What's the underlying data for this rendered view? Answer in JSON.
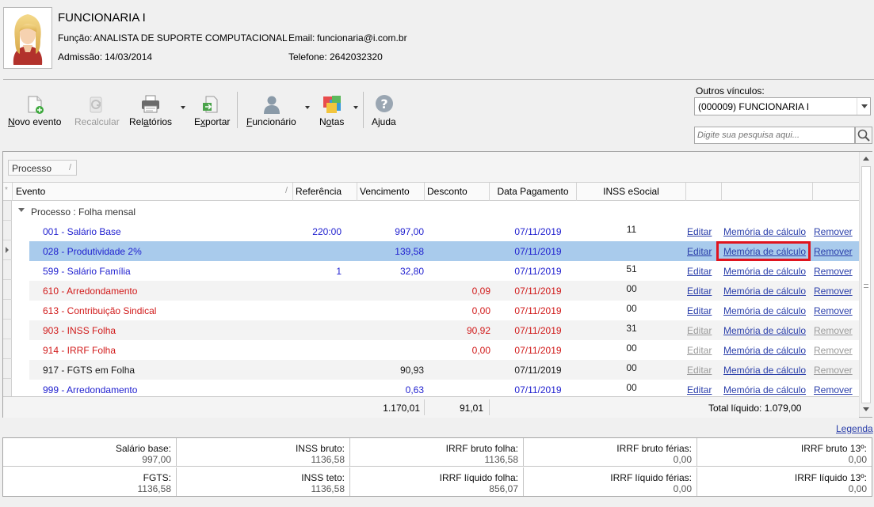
{
  "employee": {
    "name": "FUNCIONARIA I",
    "funcao_label": "Função:",
    "funcao": "ANALISTA DE SUPORTE COMPUTACIONAL",
    "email_label": "Email:",
    "email": "funcionaria@i.com.br",
    "admissao_label": "Admissão:",
    "admissao": "14/03/2014",
    "telefone_label": "Telefone:",
    "telefone": "2642032320",
    "avatar_icon": "female-user-avatar-icon"
  },
  "toolbar": {
    "novo_evento": {
      "pre": "N",
      "post": "ovo evento",
      "icon": "new-document-icon"
    },
    "recalcular": {
      "label": "Recalcular",
      "icon": "recalculate-icon",
      "disabled": true
    },
    "relatorios": {
      "pre": "Rel",
      "u": "a",
      "post": "tórios",
      "icon": "printer-icon"
    },
    "exportar": {
      "pre": "E",
      "u": "x",
      "post": "portar",
      "icon": "export-icon"
    },
    "funcionario": {
      "pre": "",
      "u": "F",
      "post": "uncionário",
      "icon": "user-icon"
    },
    "notas": {
      "pre": "N",
      "u": "o",
      "post": "tas",
      "icon": "sticky-notes-icon"
    },
    "ajuda": {
      "label": "Ajuda",
      "icon": "help-icon"
    }
  },
  "outros_vinculos": {
    "label": "Outros vínculos:",
    "selected": "(000009) FUNCIONARIA I"
  },
  "search": {
    "placeholder": "Digite sua pesquisa aqui..."
  },
  "grid": {
    "group_chip": "Processo",
    "columns": {
      "evento": "Evento",
      "referencia": "Referência",
      "vencimento": "Vencimento",
      "desconto": "Desconto",
      "data_pagamento": "Data Pagamento",
      "inss_esocial": "INSS eSocial"
    },
    "group_row": "Processo : Folha mensal",
    "rows": [
      {
        "evento": "001 - Salário Base",
        "referencia": "220:00",
        "vencimento": "997,00",
        "desconto": "",
        "data": "07/11/2019",
        "inss": "11",
        "color": "blue",
        "editar": "Editar",
        "memoria": "Memória de cálculo",
        "remover": "Remover",
        "editar_enabled": true,
        "remover_enabled": true
      },
      {
        "evento": "028 - Produtividade 2%",
        "referencia": "",
        "vencimento": "139,58",
        "desconto": "",
        "data": "07/11/2019",
        "inss": "",
        "color": "blue",
        "editar": "Editar",
        "memoria": "Memória de cálculo",
        "remover": "Remover",
        "editar_enabled": true,
        "remover_enabled": true
      },
      {
        "evento": "599 - Salário Família",
        "referencia": "1",
        "vencimento": "32,80",
        "desconto": "",
        "data": "07/11/2019",
        "inss": "51",
        "color": "blue",
        "editar": "Editar",
        "memoria": "Memória de cálculo",
        "remover": "Remover",
        "editar_enabled": true,
        "remover_enabled": true
      },
      {
        "evento": "610 - Arredondamento",
        "referencia": "",
        "vencimento": "",
        "desconto": "0,09",
        "data": "07/11/2019",
        "inss": "00",
        "color": "red",
        "editar": "Editar",
        "memoria": "Memória de cálculo",
        "remover": "Remover",
        "editar_enabled": true,
        "remover_enabled": true
      },
      {
        "evento": "613 - Contribuição Sindical",
        "referencia": "",
        "vencimento": "",
        "desconto": "0,00",
        "data": "07/11/2019",
        "inss": "00",
        "color": "red",
        "editar": "Editar",
        "memoria": "Memória de cálculo",
        "remover": "Remover",
        "editar_enabled": true,
        "remover_enabled": true
      },
      {
        "evento": "903 - INSS Folha",
        "referencia": "",
        "vencimento": "",
        "desconto": "90,92",
        "data": "07/11/2019",
        "inss": "31",
        "color": "red",
        "editar": "Editar",
        "memoria": "Memória de cálculo",
        "remover": "Remover",
        "editar_enabled": false,
        "remover_enabled": false
      },
      {
        "evento": "914 - IRRF Folha",
        "referencia": "",
        "vencimento": "",
        "desconto": "0,00",
        "data": "07/11/2019",
        "inss": "00",
        "color": "red",
        "editar": "Editar",
        "memoria": "Memória de cálculo",
        "remover": "Remover",
        "editar_enabled": false,
        "remover_enabled": false
      },
      {
        "evento": "917 - FGTS em Folha",
        "referencia": "",
        "vencimento": "90,93",
        "desconto": "",
        "data": "07/11/2019",
        "inss": "00",
        "color": "dark",
        "editar": "Editar",
        "memoria": "Memória de cálculo",
        "remover": "Remover",
        "editar_enabled": false,
        "remover_enabled": false
      },
      {
        "evento": "999 - Arredondamento",
        "referencia": "",
        "vencimento": "0,63",
        "desconto": "",
        "data": "07/11/2019",
        "inss": "00",
        "color": "blue",
        "editar": "Editar",
        "memoria": "Memória de cálculo",
        "remover": "Remover",
        "editar_enabled": true,
        "remover_enabled": true
      }
    ],
    "selected_row": 1,
    "footer": {
      "total_vencimento": "1.170,01",
      "total_desconto": "91,01",
      "total_liquido": "Total líquido: 1.079,00"
    }
  },
  "legend_link": "Legenda",
  "summary": {
    "row1": [
      {
        "label": "Salário base:",
        "value": "997,00"
      },
      {
        "label": "INSS bruto:",
        "value": "1136,58"
      },
      {
        "label": "IRRF bruto folha:",
        "value": "1136,58"
      },
      {
        "label": "IRRF bruto férias:",
        "value": "0,00"
      },
      {
        "label": "IRRF bruto 13º:",
        "value": "0,00"
      }
    ],
    "row2": [
      {
        "label": "FGTS:",
        "value": "1136,58"
      },
      {
        "label": "INSS teto:",
        "value": "1136,58"
      },
      {
        "label": "IRRF líquido folha:",
        "value": "856,07"
      },
      {
        "label": "IRRF líquido férias:",
        "value": "0,00"
      },
      {
        "label": "IRRF líquido 13º:",
        "value": "0,00"
      }
    ]
  },
  "colors": {
    "blue_event": "#1f1fcf",
    "red_event": "#d11a1a",
    "link": "#2a3eaa",
    "selection": "#a9cbec",
    "highlight_box": "#e0141e"
  }
}
